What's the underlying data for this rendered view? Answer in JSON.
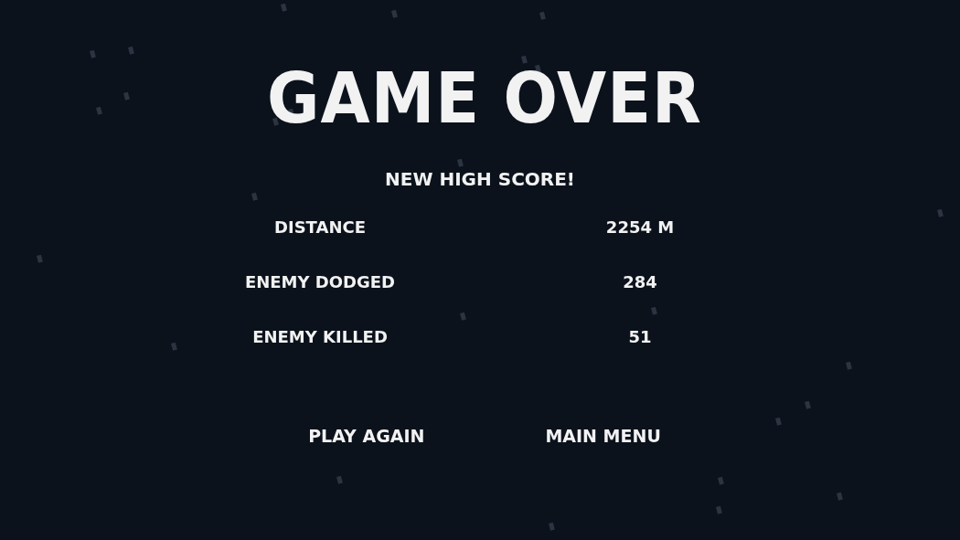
{
  "title": "GAME OVER",
  "banner": "NEW HIGH SCORE!",
  "stats": [
    {
      "label": "DISTANCE",
      "value": "2254 M"
    },
    {
      "label": "ENEMY DODGED",
      "value": "284"
    },
    {
      "label": "ENEMY KILLED",
      "value": "51"
    }
  ],
  "buttons": [
    "PLAY AGAIN",
    "MAIN MENU"
  ]
}
